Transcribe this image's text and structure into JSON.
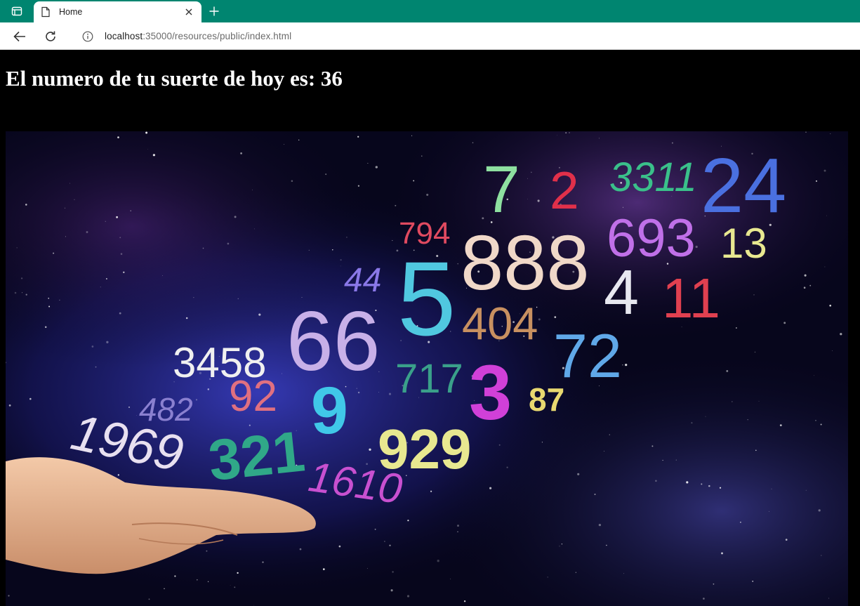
{
  "browser": {
    "tab": {
      "title": "Home"
    },
    "address": {
      "host": "localhost",
      "path": ":35000/resources/public/index.html"
    }
  },
  "page": {
    "heading": "El numero de tu suerte de hoy es: 36",
    "image": {
      "numbers": [
        "7",
        "2",
        "3311",
        "24",
        "794",
        "888",
        "693",
        "13",
        "44",
        "5",
        "4",
        "11",
        "404",
        "72",
        "3458",
        "66",
        "717",
        "3",
        "87",
        "482",
        "92",
        "9",
        "1969",
        "321",
        "929",
        "1610"
      ]
    }
  },
  "colors": {
    "tabbar": "#008570",
    "page_bg": "#000000",
    "heading": "#ffffff"
  },
  "icons": [
    "tab-strip-icon",
    "page-icon",
    "close-icon",
    "plus-icon",
    "back-arrow-icon",
    "reload-icon",
    "info-icon"
  ]
}
